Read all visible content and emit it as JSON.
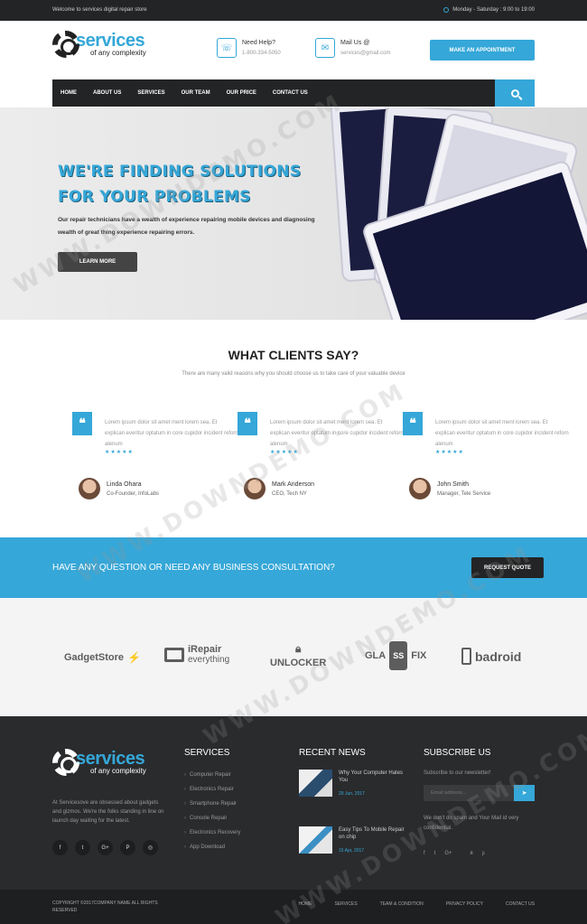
{
  "topbar": {
    "welcome": "Welcome to services digital repair store",
    "hours": "Monday - Saturday : 9:00 to 19:00"
  },
  "logo": {
    "brand": "services",
    "tagline": "of any complexity"
  },
  "header": {
    "help_title": "Need Help?",
    "help_phone": "1-800-334-5050",
    "mail_title": "Mail Us @",
    "mail_value": "services@gmail.com",
    "appointment_button": "MAKE AN APPOINTMENT"
  },
  "nav": {
    "items": [
      "HOME",
      "ABOUT US",
      "SERVICES",
      "OUR TEAM",
      "OUR PRICE",
      "CONTACT US"
    ]
  },
  "hero": {
    "title_line1": "WE'RE FINDING SOLUTIONS",
    "title_line2": "FOR YOUR PROBLEMS",
    "text": "Our repair technicians have a wealth of experience repairing mobile devices and diagnosing wealth of great thing experience repairing errors.",
    "button": "LEARN MORE"
  },
  "clients": {
    "title": "WHAT CLIENTS SAY?",
    "subtitle": "There are many valid reasons why you should choose us to take care of your valuable device",
    "testimonials": [
      {
        "text": "Lorem ipsum dolor sit amet ment lorem sea. Et explican everitur optatum in core cupidor incident reforn alenum",
        "stars": "★★★★★",
        "name": "Linda Ohara",
        "role": "Co-Founder, InfoLabs"
      },
      {
        "text": "Lorem ipsum dolor sit amet ment lorem sea. Et explican everitur optatum in core cupidor incident reforn alenum",
        "stars": "★★★★★",
        "name": "Mark Anderson",
        "role": "CEO, Tech NY"
      },
      {
        "text": "Lorem ipsum dolor sit amet ment lorem sea. Et explican everitur optatum in core cupidor incident reforn alenum",
        "stars": "★★★★★",
        "name": "John Smith",
        "role": "Manager, Tele Service"
      }
    ]
  },
  "consult": {
    "question": "HAVE ANY QUESTION OR NEED ANY BUSINESS CONSULTATION?",
    "button": "REQUEST QUOTE"
  },
  "partners": {
    "gadget": "GadgetStore",
    "irepair_1": "iRepair",
    "irepair_2": "everything",
    "unlocker": "UNLOCKER",
    "glass_a": "GLA",
    "glass_b": "SS",
    "glass_c": "FIX",
    "badroid": "badroid"
  },
  "footer": {
    "about": "At Servicesove are obsessed about gadgets and gizmos. We're the folks standing in line on launch day waiting for the latest.",
    "socials": [
      "f",
      "t",
      "G+",
      "P",
      "◎"
    ],
    "services_title": "SERVICES",
    "services": [
      "Computer Repair",
      "Electronics Repair",
      "Smartphone Repair",
      "Console Repair",
      "Electronics Recovery",
      "App Download"
    ],
    "news_title": "RECENT NEWS",
    "news": [
      {
        "title": "Why Your Computer Hates You",
        "date": "29 Jun, 2017"
      },
      {
        "title": "Easy Tips To Mobile Repair on chip",
        "date": "15 Apr, 2017"
      }
    ],
    "subscribe_title": "SUBSCRIBE US",
    "subscribe_text": "Subscribe to our newsletter!",
    "email_placeholder": "Email address...",
    "spam_text": "We don't do spam and Your Mail id very confidential.",
    "sub_socials": [
      "f",
      "t",
      "G+",
      "ʀ",
      "ʂ"
    ]
  },
  "bottom": {
    "copyright": "COPYRIGHT ©2017COMPANY NAME ALL RIGHTS RESERVED",
    "links": [
      "HOME",
      "SERVICES",
      "TEAM & CONDITION",
      "PRIVACY POLICY",
      "CONTACT US"
    ]
  },
  "watermark": "WWW.DOWNDEMO.COM",
  "colors": {
    "accent": "#35a7d8",
    "dark": "#232425",
    "footer": "#2a2b2d"
  }
}
